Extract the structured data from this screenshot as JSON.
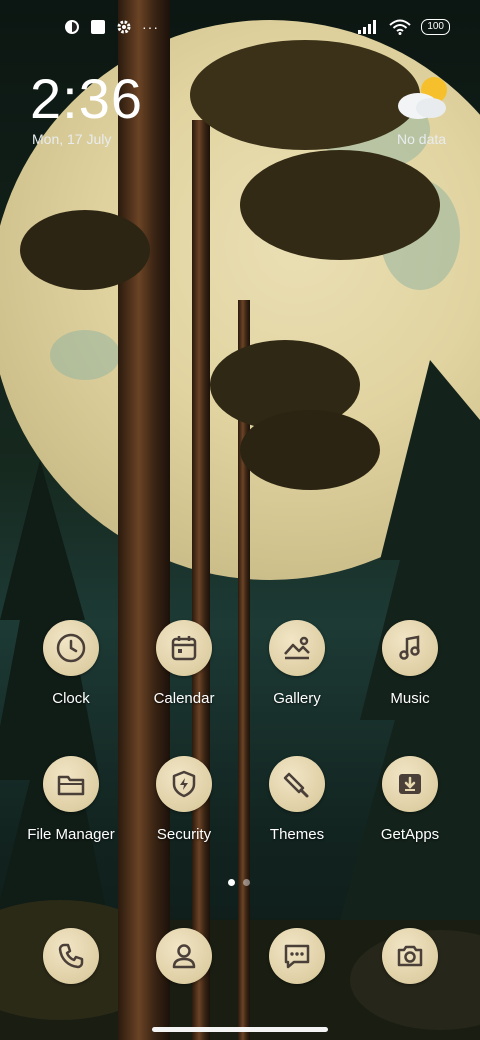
{
  "status_bar": {
    "left_icons": [
      "notification-app-icon",
      "notification-square-icon",
      "settings-gear-icon",
      "more-dots-icon"
    ],
    "more_glyph": "···",
    "right_icons": [
      "signal-icon",
      "wifi-icon"
    ],
    "battery_level": "100"
  },
  "clock_widget": {
    "time": "2:36",
    "date": "Mon, 17 July"
  },
  "weather_widget": {
    "icon": "partly-cloudy-icon",
    "status": "No data"
  },
  "apps": [
    {
      "label": "Clock",
      "icon": "clock-icon"
    },
    {
      "label": "Calendar",
      "icon": "calendar-icon"
    },
    {
      "label": "Gallery",
      "icon": "gallery-icon"
    },
    {
      "label": "Music",
      "icon": "music-note-icon"
    },
    {
      "label": "File Manager",
      "icon": "folder-icon"
    },
    {
      "label": "Security",
      "icon": "shield-bolt-icon"
    },
    {
      "label": "Themes",
      "icon": "paintbrush-icon"
    },
    {
      "label": "GetApps",
      "icon": "download-box-icon"
    }
  ],
  "page_indicator": {
    "current": 1,
    "total": 2
  },
  "dock": [
    {
      "icon": "phone-icon"
    },
    {
      "icon": "contacts-icon"
    },
    {
      "icon": "messages-icon"
    },
    {
      "icon": "camera-icon"
    }
  ],
  "colors": {
    "icon_fill": "#e6d7af",
    "icon_glyph": "#4a4039",
    "moon": "#e1d4a1",
    "sky": "#1d3a35"
  }
}
